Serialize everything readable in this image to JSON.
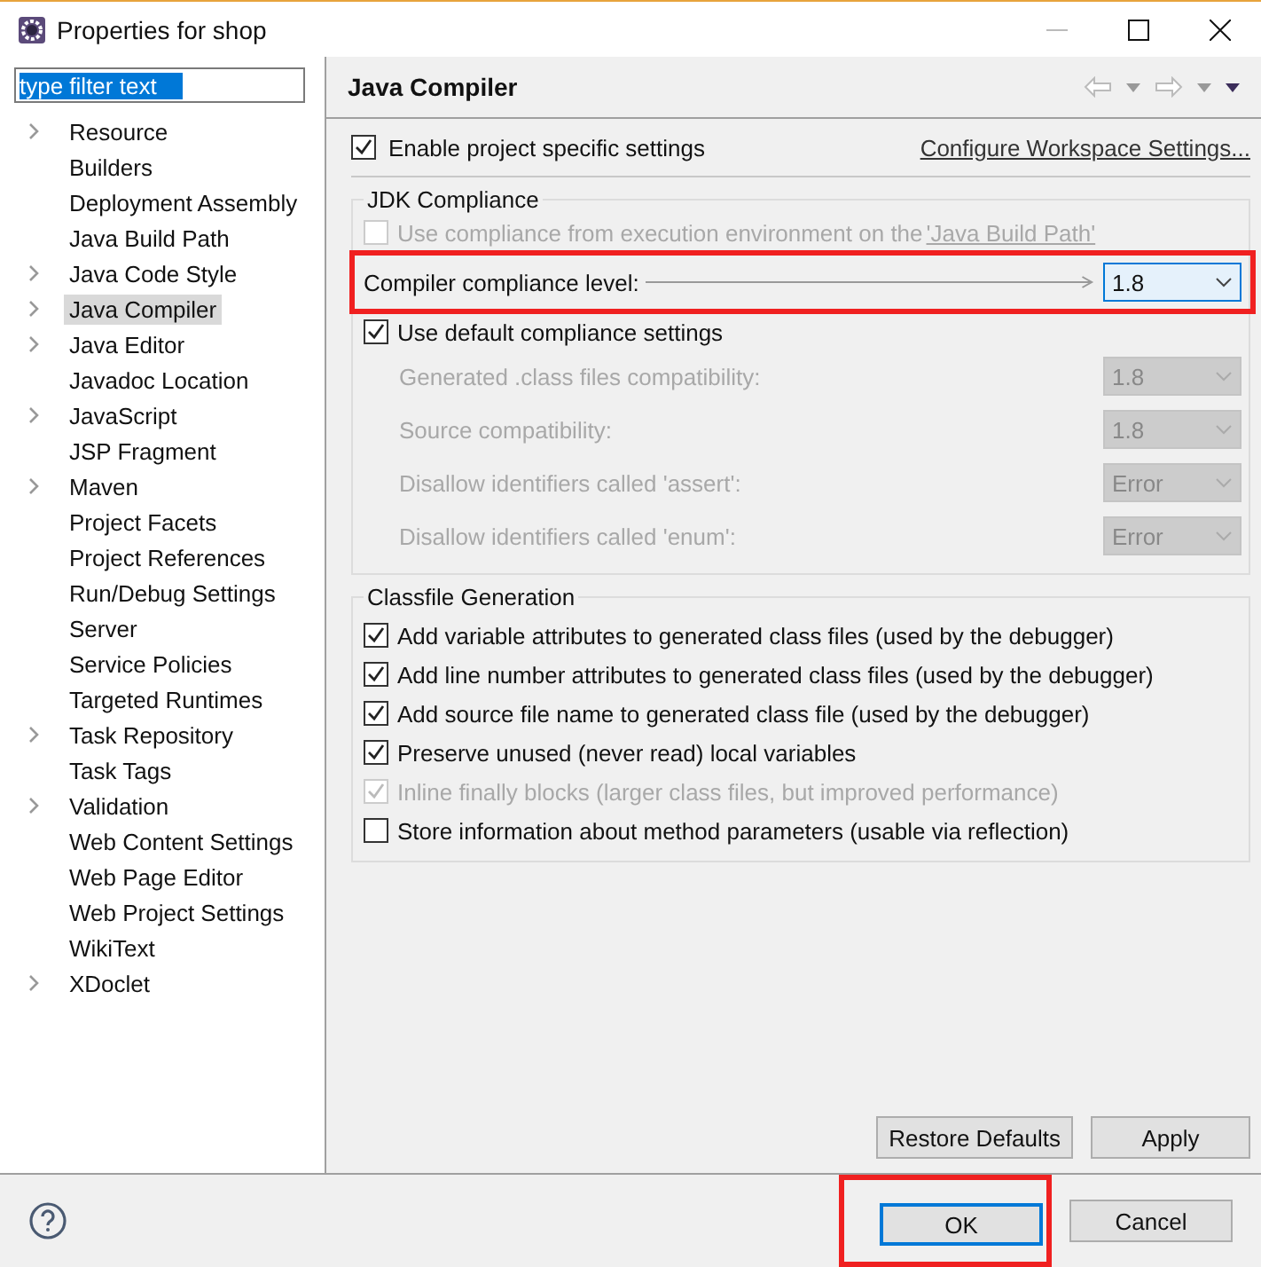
{
  "window": {
    "title": "Properties for shop"
  },
  "filter": {
    "value": "type filter text"
  },
  "tree": [
    {
      "label": "Resource",
      "expandable": true,
      "selected": false
    },
    {
      "label": "Builders",
      "expandable": false,
      "selected": false
    },
    {
      "label": "Deployment Assembly",
      "expandable": false,
      "selected": false
    },
    {
      "label": "Java Build Path",
      "expandable": false,
      "selected": false
    },
    {
      "label": "Java Code Style",
      "expandable": true,
      "selected": false
    },
    {
      "label": "Java Compiler",
      "expandable": true,
      "selected": true
    },
    {
      "label": "Java Editor",
      "expandable": true,
      "selected": false
    },
    {
      "label": "Javadoc Location",
      "expandable": false,
      "selected": false
    },
    {
      "label": "JavaScript",
      "expandable": true,
      "selected": false
    },
    {
      "label": "JSP Fragment",
      "expandable": false,
      "selected": false
    },
    {
      "label": "Maven",
      "expandable": true,
      "selected": false
    },
    {
      "label": "Project Facets",
      "expandable": false,
      "selected": false
    },
    {
      "label": "Project References",
      "expandable": false,
      "selected": false
    },
    {
      "label": "Run/Debug Settings",
      "expandable": false,
      "selected": false
    },
    {
      "label": "Server",
      "expandable": false,
      "selected": false
    },
    {
      "label": "Service Policies",
      "expandable": false,
      "selected": false
    },
    {
      "label": "Targeted Runtimes",
      "expandable": false,
      "selected": false
    },
    {
      "label": "Task Repository",
      "expandable": true,
      "selected": false
    },
    {
      "label": "Task Tags",
      "expandable": false,
      "selected": false
    },
    {
      "label": "Validation",
      "expandable": true,
      "selected": false
    },
    {
      "label": "Web Content Settings",
      "expandable": false,
      "selected": false
    },
    {
      "label": "Web Page Editor",
      "expandable": false,
      "selected": false
    },
    {
      "label": "Web Project Settings",
      "expandable": false,
      "selected": false
    },
    {
      "label": "WikiText",
      "expandable": false,
      "selected": false
    },
    {
      "label": "XDoclet",
      "expandable": true,
      "selected": false
    }
  ],
  "page": {
    "title": "Java Compiler"
  },
  "enable": {
    "label": "Enable project specific settings",
    "checked": true
  },
  "workspace_link": "Configure Workspace Settings...",
  "jdk": {
    "title": "JDK Compliance",
    "use_env": {
      "label": "Use compliance from execution environment on the ",
      "link": "'Java Build Path'",
      "checked": false,
      "disabled": true
    },
    "compliance": {
      "label": "Compiler compliance level:",
      "value": "1.8",
      "highlighted": true
    },
    "use_default": {
      "label": "Use default compliance settings",
      "checked": true
    },
    "settings": [
      {
        "label": "Generated .class files compatibility:",
        "value": "1.8",
        "disabled": true
      },
      {
        "label": "Source compatibility:",
        "value": "1.8",
        "disabled": true
      },
      {
        "label": "Disallow identifiers called 'assert':",
        "value": "Error",
        "disabled": true
      },
      {
        "label": "Disallow identifiers called 'enum':",
        "value": "Error",
        "disabled": true
      }
    ]
  },
  "classfile": {
    "title": "Classfile Generation",
    "options": [
      {
        "label": "Add variable attributes to generated class files (used by the debugger)",
        "checked": true,
        "disabled": false
      },
      {
        "label": "Add line number attributes to generated class files (used by the debugger)",
        "checked": true,
        "disabled": false
      },
      {
        "label": "Add source file name to generated class file (used by the debugger)",
        "checked": true,
        "disabled": false
      },
      {
        "label": "Preserve unused (never read) local variables",
        "checked": true,
        "disabled": false
      },
      {
        "label": "Inline finally blocks (larger class files, but improved performance)",
        "checked": true,
        "disabled": true
      },
      {
        "label": "Store information about method parameters (usable via reflection)",
        "checked": false,
        "disabled": false
      }
    ]
  },
  "page_buttons": [
    "Restore Defaults",
    "Apply"
  ],
  "dialog_buttons": [
    {
      "label": "OK",
      "default": true,
      "highlighted": true
    },
    {
      "label": "Cancel",
      "default": false,
      "highlighted": false
    }
  ]
}
